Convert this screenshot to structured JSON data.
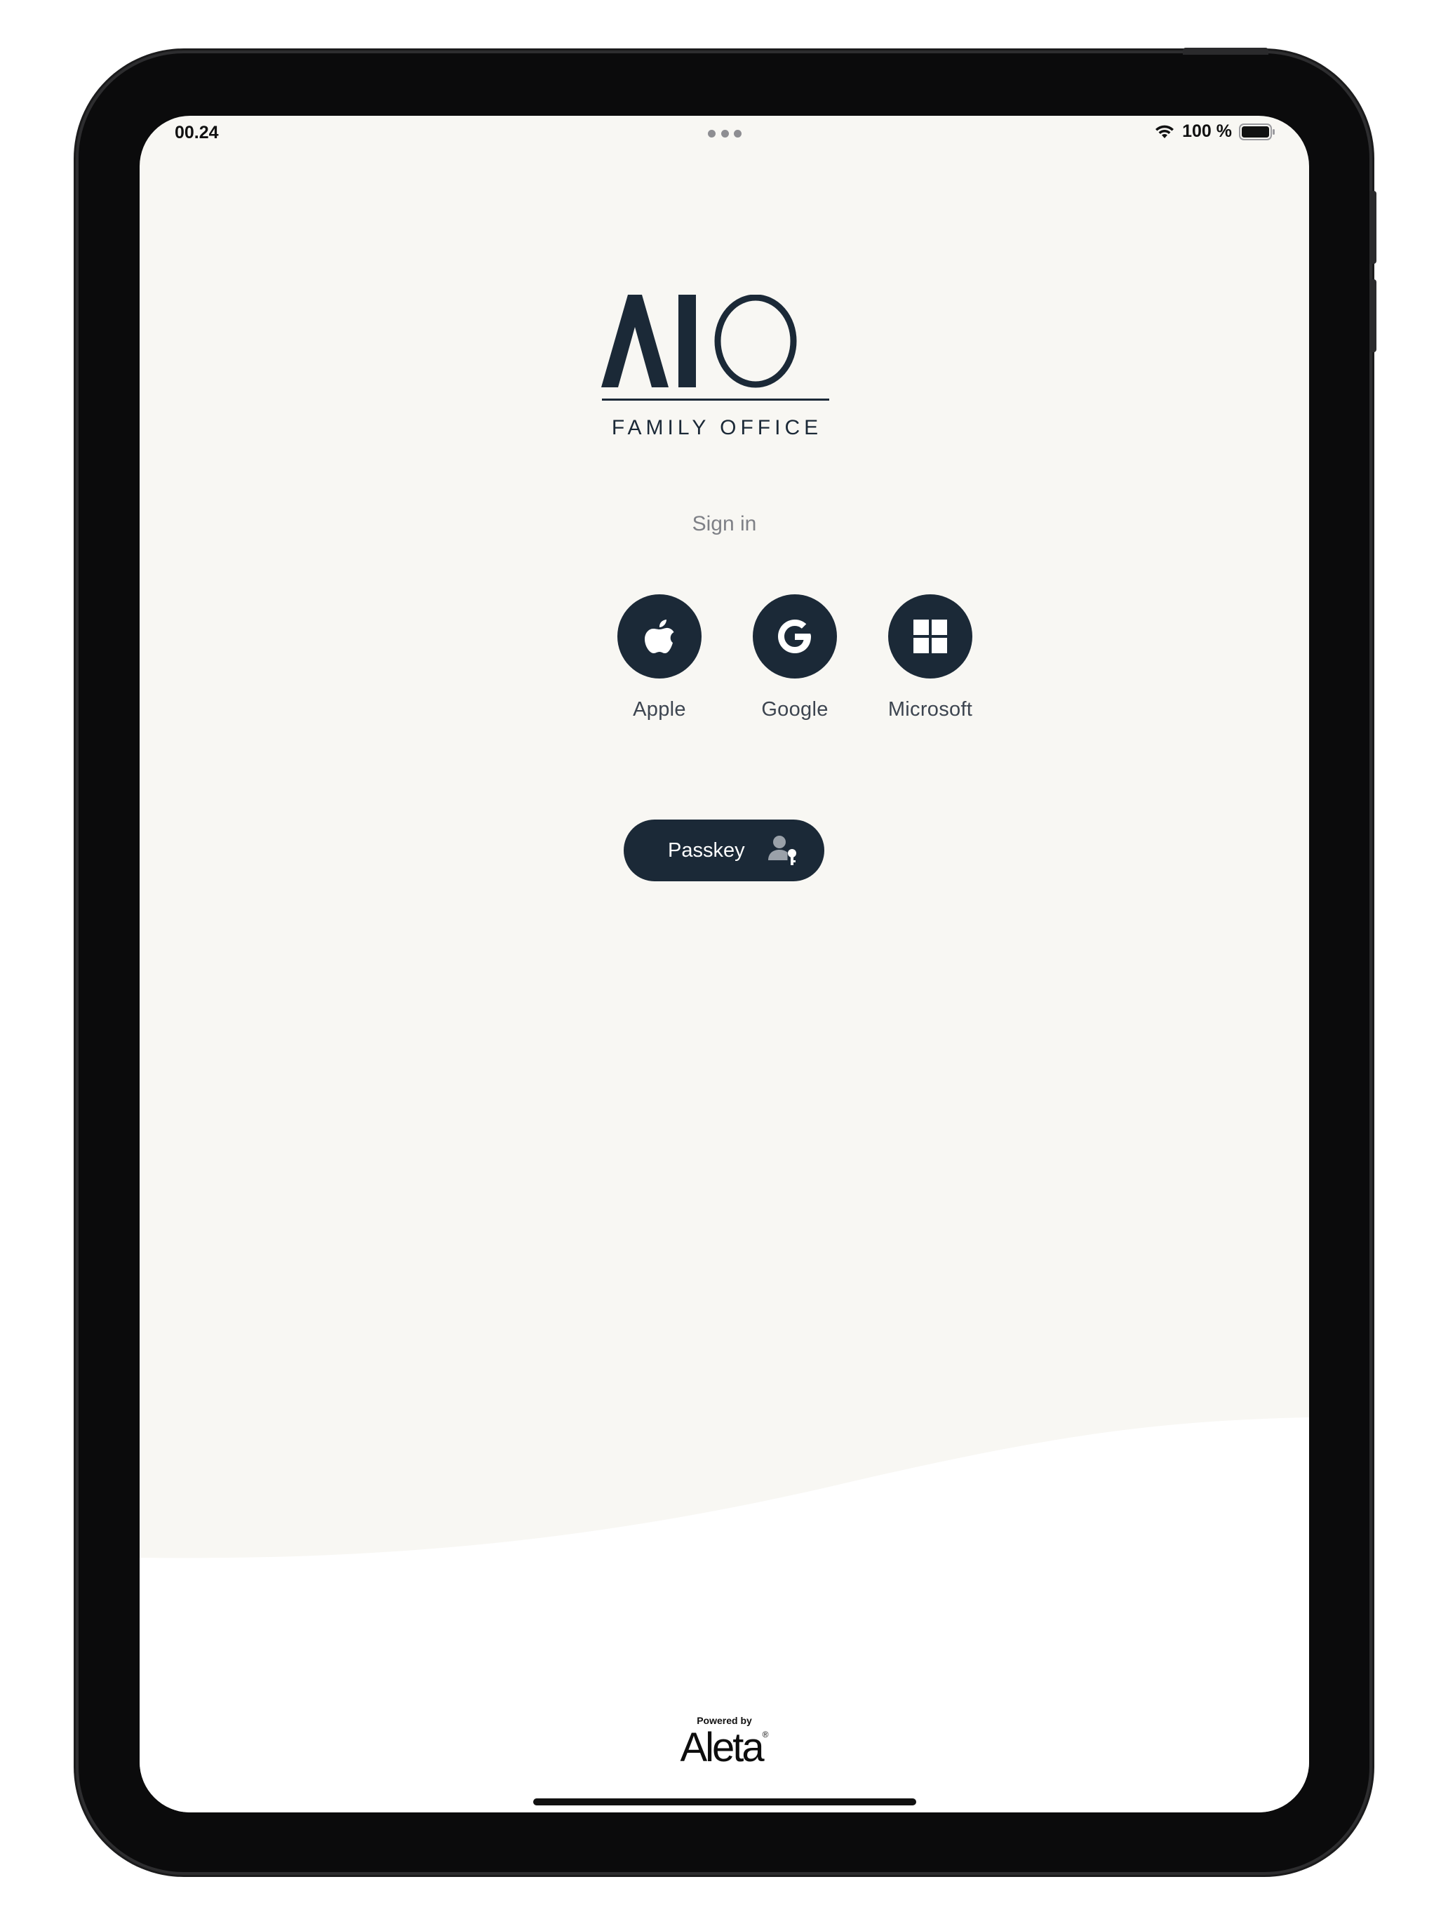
{
  "status_bar": {
    "time": "00.24",
    "battery": "100 %",
    "icons": [
      "wifi-icon",
      "battery-icon",
      "multitask-dots-icon"
    ]
  },
  "brand": {
    "logo_text": "AIO",
    "tagline": "FAMILY OFFICE"
  },
  "signin": {
    "title": "Sign in",
    "providers": [
      {
        "label": "Apple",
        "icon": "apple-icon"
      },
      {
        "label": "Google",
        "icon": "google-icon"
      },
      {
        "label": "Microsoft",
        "icon": "windows-icon"
      }
    ],
    "passkey_label": "Passkey",
    "passkey_icon": "user-key-icon"
  },
  "footer": {
    "powered_by": "Powered by",
    "brand": "Aleta",
    "brand_mark": "®"
  },
  "colors": {
    "primary": "#1b2937",
    "background": "#f8f7f3",
    "text_muted": "#7f8187"
  }
}
